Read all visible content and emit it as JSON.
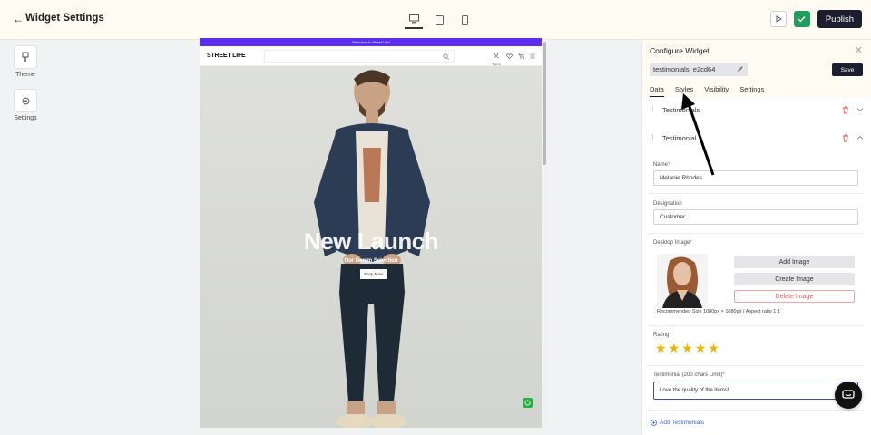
{
  "topbar": {
    "title": "Widget Settings",
    "publish_label": "Publish",
    "devices": [
      "desktop-icon",
      "tablet-icon",
      "mobile-icon"
    ],
    "active_device": "desktop"
  },
  "rail": {
    "items": [
      {
        "label": "Theme",
        "icon": "paint-brush-icon"
      },
      {
        "label": "Settings",
        "icon": "gear-icon"
      }
    ]
  },
  "preview": {
    "announcement": "Welcome to Street Life!",
    "logo": "STREET LIFE",
    "nav_sign_in": "Sign In",
    "hero_title": "New Launch",
    "hero_subtitle": "Our Denim Selection",
    "hero_button": "Shop Now"
  },
  "panel": {
    "title": "Configure Widget",
    "widget_id": "testimonials_e2cd64",
    "save_label": "Save",
    "tabs": [
      "Data",
      "Styles",
      "Visibility",
      "Settings"
    ],
    "active_tab": "Data",
    "accordions": [
      {
        "label": "Testimonials",
        "expanded": false
      },
      {
        "label": "Testimonial",
        "expanded": true
      }
    ],
    "fields": {
      "name_label": "Name",
      "name_value": "Melanie Rhodes",
      "designation_label": "Designation",
      "designation_value": "Customer",
      "desktop_image_label": "Desktop Image",
      "add_image": "Add Image",
      "create_image": "Create Image",
      "delete_image": "Delete Image",
      "image_note": "Recommended Size 1080px × 1080px / Aspect ratio 1:1",
      "rating_label": "Rating",
      "rating_value": 5,
      "testimonial_label": "Testimonial (200 chars Limit)",
      "testimonial_value": "Love the quality of the items!"
    },
    "add_link": "Add Testimonials"
  },
  "colors": {
    "accent_dark": "#1d1d30",
    "announcement": "#5b2ef0",
    "star": "#f0b400",
    "delete": "#e45b5b",
    "link": "#3b6ad6"
  }
}
